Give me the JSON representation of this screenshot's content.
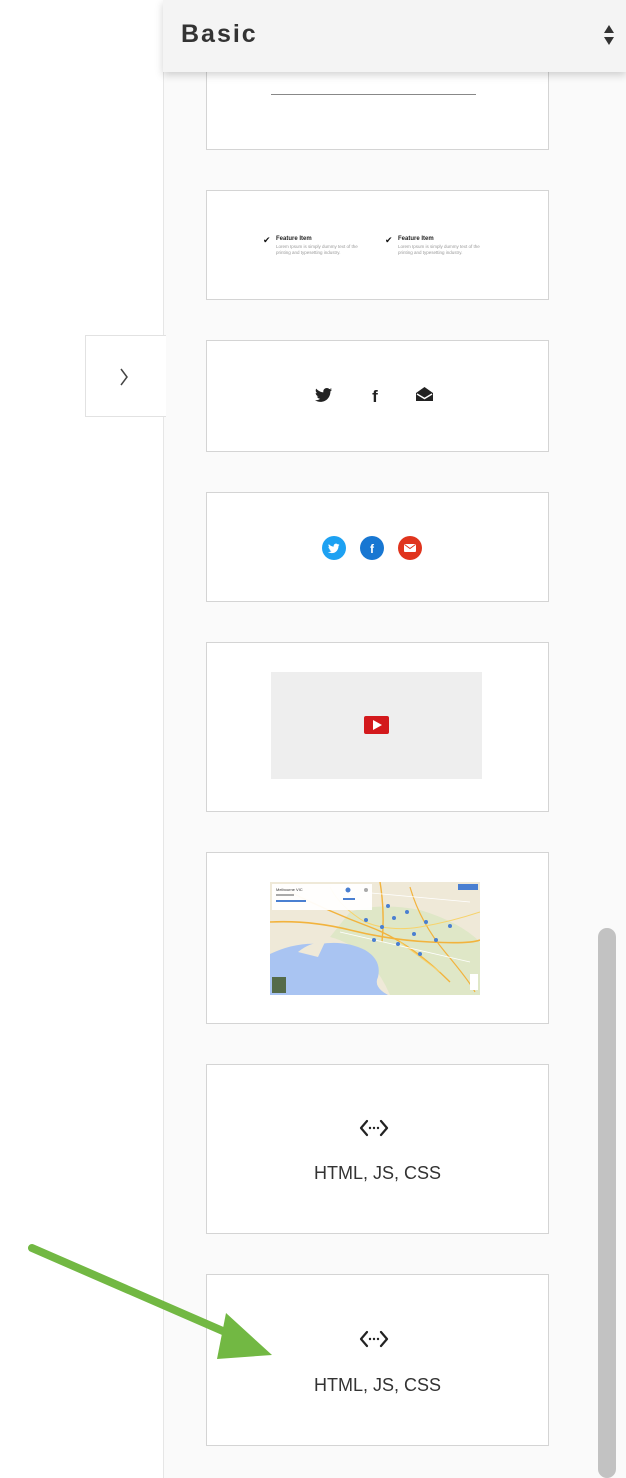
{
  "header": {
    "title": "Basic"
  },
  "features": [
    {
      "title": "Feature Item",
      "body": "Lorem Ipsum is simply dummy text of the printing and typesetting industry."
    },
    {
      "title": "Feature Item",
      "body": "Lorem Ipsum is simply dummy text of the printing and typesetting industry."
    }
  ],
  "social_plain": [
    "twitter-icon",
    "facebook-icon",
    "email-icon"
  ],
  "social_round": [
    {
      "icon": "twitter-icon",
      "color": "#1da1f2"
    },
    {
      "icon": "facebook-icon",
      "color": "#1877d2"
    },
    {
      "icon": "email-icon",
      "color": "#e0341d"
    }
  ],
  "video": {
    "play_color": "#d3191c"
  },
  "map": {
    "place": "Melbourne VIC"
  },
  "code_blocks": [
    {
      "label": "HTML, JS, CSS"
    },
    {
      "label": "HTML, JS, CSS"
    }
  ],
  "colors": {
    "arrow": "#72b843"
  }
}
